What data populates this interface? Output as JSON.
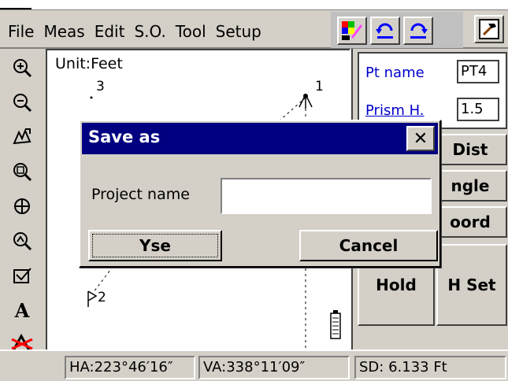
{
  "menubar": {
    "items": [
      "File",
      "Meas",
      "Edit",
      "S.O.",
      "Tool",
      "Setup"
    ]
  },
  "toolbar_icons": [
    "color-palette-icon",
    "undo-icon",
    "redo-icon",
    "hammer-icon"
  ],
  "left_tools": [
    "zoom-in-icon",
    "zoom-out-icon",
    "pan-icon",
    "zoom-window-icon",
    "zoom-extents-icon",
    "zoom-center-icon",
    "layer-icon",
    "text-icon",
    "cad-icon"
  ],
  "canvas": {
    "unit_label": "Unit:Feet",
    "points": [
      {
        "label": "3"
      },
      {
        "label": "1"
      },
      {
        "label": "2"
      }
    ]
  },
  "right_panel": {
    "pt_name_label": "Pt name",
    "pt_name_value": "PT4",
    "prism_label": "Prism H.",
    "prism_value": "1.5",
    "buttons": {
      "dist": "Dist",
      "angle": "ngle",
      "coord": "oord",
      "hold": "Hold",
      "hset": "H Set"
    }
  },
  "status": {
    "ha": "HA:223°46′16″",
    "va": "VA:338°11′09″",
    "sd": "SD:   6.133 Ft"
  },
  "dialog": {
    "title": "Save as",
    "close": "✕",
    "project_label": "Project name",
    "project_value": "",
    "yes_label": "Yse",
    "cancel_label": "Cancel"
  }
}
